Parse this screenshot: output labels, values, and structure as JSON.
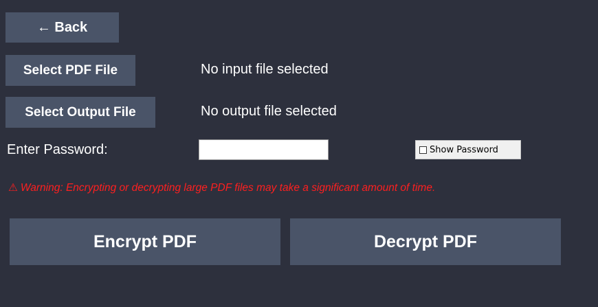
{
  "toolbar": {
    "back_label": "← Back"
  },
  "files": {
    "select_pdf_label": "Select PDF File",
    "input_status": "No input file selected",
    "select_output_label": "Select Output File",
    "output_status": "No output file selected"
  },
  "password": {
    "label": "Enter Password:",
    "value": "",
    "show_password_label": "Show Password",
    "show_password_checked": false
  },
  "warning": {
    "icon": "⚠",
    "text": "Warning: Encrypting or decrypting large PDF files may take a significant amount of time.",
    "color": "#ff1f1f"
  },
  "actions": {
    "encrypt_label": "Encrypt PDF",
    "decrypt_label": "Decrypt PDF"
  },
  "theme": {
    "background": "#2d303d",
    "button": "#4a5468"
  }
}
